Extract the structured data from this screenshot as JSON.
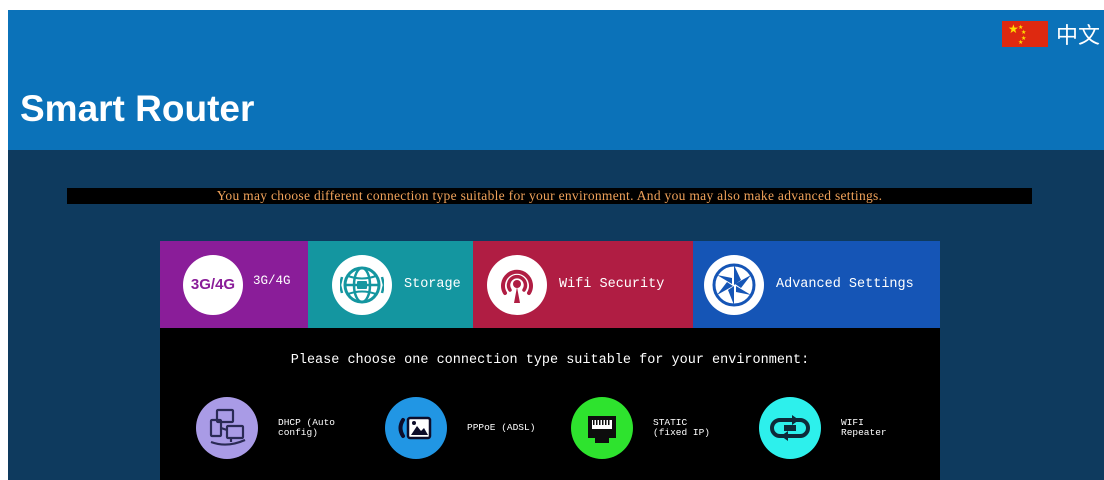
{
  "header": {
    "title": "Smart Router",
    "language": {
      "label": "中文",
      "flag": "china-flag-icon"
    }
  },
  "notice": "You may choose different connection type suitable for your environment. And you may also make advanced settings.",
  "tabs": [
    {
      "label": "3G/4G",
      "badge": "3G/4G",
      "icon": "3g-4g-badge-icon",
      "color": "#8a1d99"
    },
    {
      "label": "Storage",
      "icon": "storage-globe-icon",
      "color": "#1496a0"
    },
    {
      "label": "Wifi Security",
      "icon": "wifi-security-icon",
      "color": "#b01d43"
    },
    {
      "label": "Advanced Settings",
      "icon": "aperture-icon",
      "color": "#1555b6"
    }
  ],
  "prompt": "Please choose one connection type suitable for your environment:",
  "connection_types": [
    {
      "label": "DHCP (Auto config)",
      "icon": "network-computers-icon",
      "color": "#a99be6"
    },
    {
      "label": "PPPoE (ADSL)",
      "icon": "modem-icon",
      "color": "#2196e4"
    },
    {
      "label": "STATIC (fixed IP)",
      "icon": "ethernet-port-icon",
      "color": "#2ee32e"
    },
    {
      "label": "WIFI Repeater",
      "icon": "repeater-loop-icon",
      "color": "#2df0ec"
    }
  ]
}
